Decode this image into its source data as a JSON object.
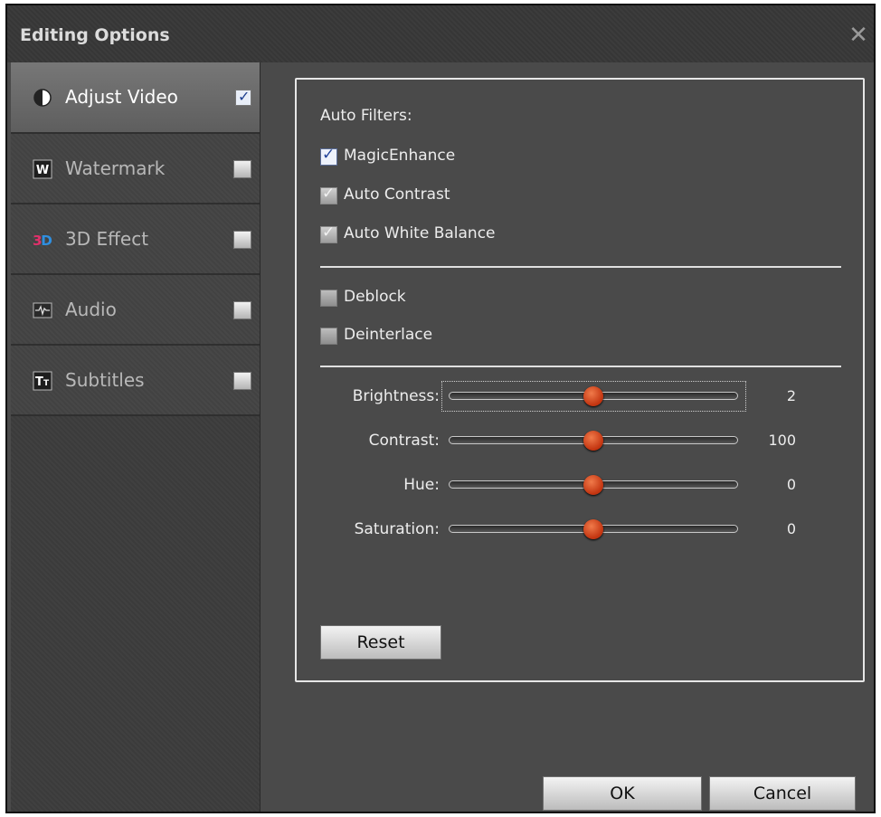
{
  "window": {
    "title": "Editing Options",
    "close_glyph": "✕"
  },
  "sidebar": {
    "items": [
      {
        "label": "Adjust Video",
        "icon": "contrast-circle-icon",
        "checked": true,
        "active": true
      },
      {
        "label": "Watermark",
        "icon": "watermark-w-icon",
        "checked": false,
        "active": false
      },
      {
        "label": "3D Effect",
        "icon": "3d-icon",
        "checked": false,
        "active": false
      },
      {
        "label": "Audio",
        "icon": "audio-waveform-icon",
        "checked": false,
        "active": false
      },
      {
        "label": "Subtitles",
        "icon": "subtitles-tt-icon",
        "checked": false,
        "active": false
      }
    ]
  },
  "panel": {
    "auto_filters_label": "Auto Filters:",
    "filters": [
      {
        "label": "MagicEnhance",
        "state": "checked"
      },
      {
        "label": "Auto Contrast",
        "state": "checked-disabled"
      },
      {
        "label": "Auto White Balance",
        "state": "checked-disabled"
      }
    ],
    "options": [
      {
        "label": "Deblock",
        "state": "unchecked"
      },
      {
        "label": "Deinterlace",
        "state": "unchecked"
      }
    ],
    "sliders": [
      {
        "label": "Brightness:",
        "value": "2",
        "position": 0.5
      },
      {
        "label": "Contrast:",
        "value": "100",
        "position": 0.5
      },
      {
        "label": "Hue:",
        "value": "0",
        "position": 0.5
      },
      {
        "label": "Saturation:",
        "value": "0",
        "position": 0.5
      }
    ],
    "reset_label": "Reset"
  },
  "footer": {
    "ok_label": "OK",
    "cancel_label": "Cancel"
  },
  "colors": {
    "accent_thumb": "#d9481c",
    "window_bg": "#4a4a4a"
  }
}
